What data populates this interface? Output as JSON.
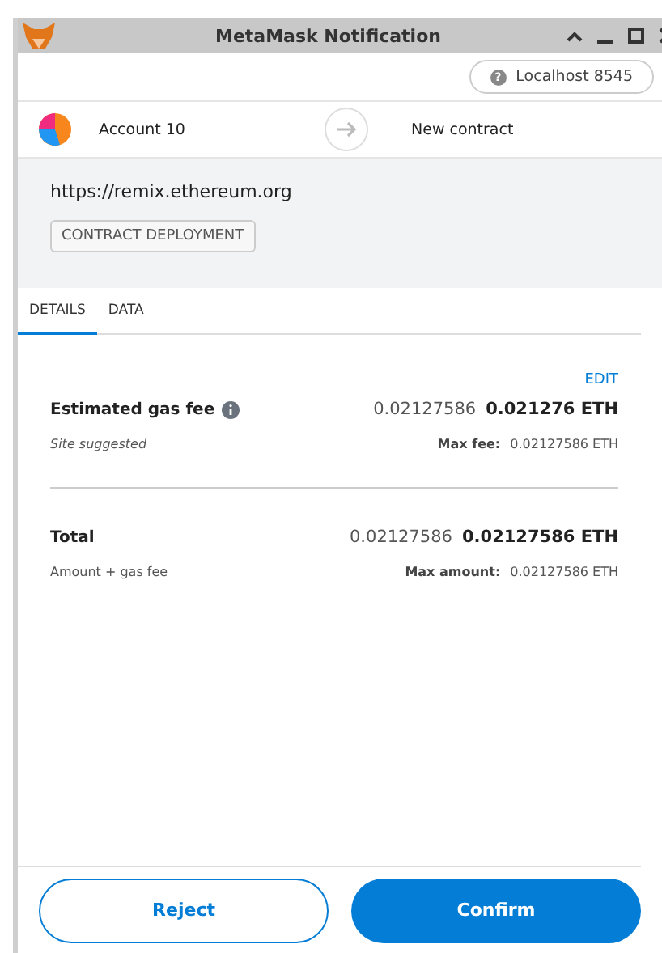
{
  "window": {
    "title": "MetaMask Notification"
  },
  "network": {
    "label": "Localhost 8545",
    "icon": "?"
  },
  "account": {
    "name": "Account 10"
  },
  "recipient": {
    "label": "New contract"
  },
  "origin": {
    "url": "https://remix.ethereum.org",
    "tag": "CONTRACT DEPLOYMENT"
  },
  "tabs": [
    {
      "label": "DETAILS",
      "selected": true
    },
    {
      "label": "DATA",
      "selected": false
    }
  ],
  "edit_link": "EDIT",
  "rows": [
    {
      "label": "Estimated gas fee",
      "info": true,
      "secondary": "0.02127586",
      "primary": "0.021276 ETH",
      "sublabel": "Site suggested",
      "sublabel_italic": true,
      "max_label": "Max fee:",
      "max_value": "0.02127586 ETH"
    },
    {
      "label": "Total",
      "info": false,
      "secondary": "0.02127586",
      "primary": "0.02127586 ETH",
      "sublabel": "Amount + gas fee",
      "sublabel_italic": false,
      "max_label": "Max amount:",
      "max_value": "0.02127586 ETH"
    }
  ],
  "buttons": [
    {
      "label": "Reject",
      "kind": "secondary"
    },
    {
      "label": "Confirm",
      "kind": "primary"
    }
  ]
}
